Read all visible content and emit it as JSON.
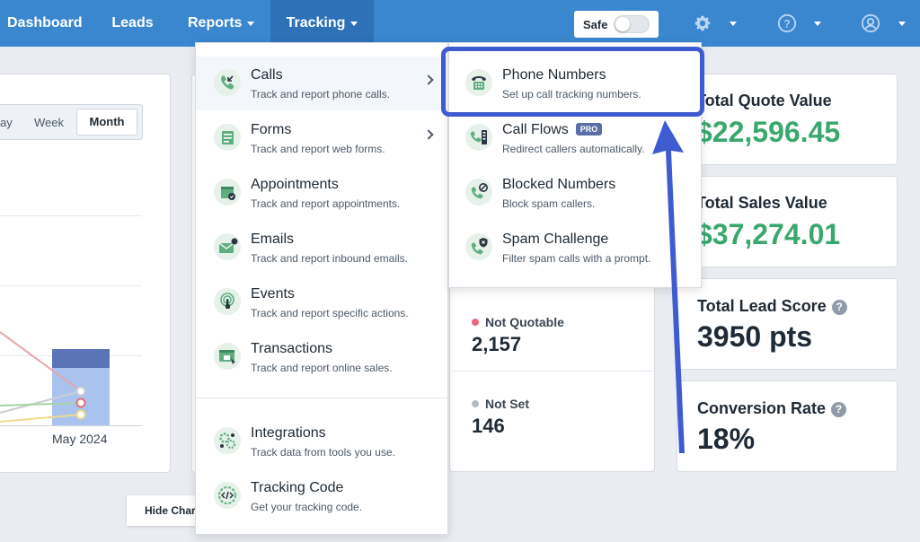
{
  "nav": {
    "dashboard": "Dashboard",
    "leads": "Leads",
    "reports": "Reports",
    "tracking": "Tracking",
    "safe_label": "Safe",
    "safe_on": false
  },
  "icons": {
    "settings": "gear-icon",
    "help": "question-circle-icon",
    "account": "user-circle-icon"
  },
  "period": {
    "day_partial": "ay",
    "week": "Week",
    "month": "Month",
    "selected": "Month"
  },
  "chart": {
    "x_label": "May 2024"
  },
  "menu": {
    "items": [
      {
        "title": "Calls",
        "desc": "Track and report phone calls.",
        "submenu": true
      },
      {
        "title": "Forms",
        "desc": "Track and report web forms.",
        "submenu": true
      },
      {
        "title": "Appointments",
        "desc": "Track and report appointments."
      },
      {
        "title": "Emails",
        "desc": "Track and report inbound emails."
      },
      {
        "title": "Events",
        "desc": "Track and report specific actions."
      },
      {
        "title": "Transactions",
        "desc": "Track and report online sales."
      },
      {
        "title": "Integrations",
        "desc": "Track data from tools you use."
      },
      {
        "title": "Tracking Code",
        "desc": "Get your tracking code."
      }
    ]
  },
  "submenu": {
    "items": [
      {
        "title": "Phone Numbers",
        "desc": "Set up call tracking numbers."
      },
      {
        "title": "Call Flows",
        "desc": "Redirect callers automatically.",
        "badge": "PRO"
      },
      {
        "title": "Blocked Numbers",
        "desc": "Block spam callers."
      },
      {
        "title": "Spam Challenge",
        "desc": "Filter spam calls with a prompt."
      }
    ]
  },
  "statuses": [
    {
      "label": "Not Quotable",
      "value": "2,157",
      "color": "#e86a78"
    },
    {
      "label": "Not Set",
      "value": "146",
      "color": "#b3bac3"
    }
  ],
  "stats": [
    {
      "title": "Total Quote Value",
      "value": "$22,596.45",
      "color": "#3aa76d"
    },
    {
      "title": "Total Sales Value",
      "value": "$37,274.01",
      "color": "#3aa76d"
    },
    {
      "title": "Total Lead Score",
      "value": "3950 pts",
      "color": "#1e2a35",
      "help": "?"
    },
    {
      "title": "Conversion Rate",
      "value": "18%",
      "color": "#1e2a35",
      "help": "?"
    }
  ],
  "footer": {
    "hide_chart": "Hide Char"
  },
  "colors": {
    "nav_bg": "#3a87d0",
    "nav_active": "#2f71b7",
    "highlight": "#3f5bd0",
    "green": "#3aa76d"
  }
}
